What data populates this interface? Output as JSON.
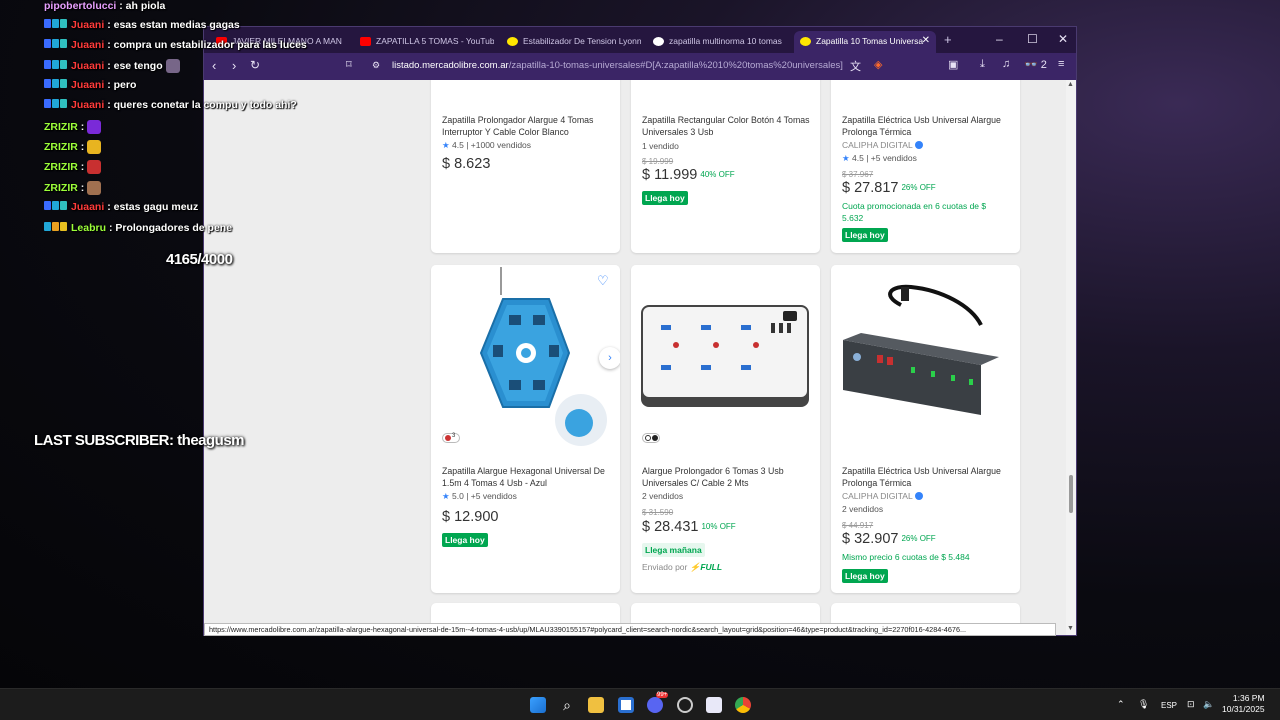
{
  "chat": {
    "messages": [
      {
        "user": "pipobertolucci",
        "color": "#e8a0ff",
        "text": ": ah piola",
        "badges": 0
      },
      {
        "user": "Juaani",
        "color": "#ff3b3b",
        "text": ": esas estan medias gagas",
        "badges": 3
      },
      {
        "user": "Juaani",
        "color": "#ff3b3b",
        "text": ": compra un estabilizador para las luces",
        "badges": 3
      },
      {
        "user": "Juaani",
        "color": "#ff3b3b",
        "text": ": ese tengo",
        "badges": 3
      },
      {
        "user": "Juaani",
        "color": "#ff3b3b",
        "text": ": pero",
        "badges": 3
      },
      {
        "user": "Juaani",
        "color": "#ff3b3b",
        "text": ": queres conetar la compu y todo ahi?",
        "badges": 3
      },
      {
        "user": "ZRIZIR",
        "color": "#9cff3a",
        "text": ":",
        "badges": 0
      },
      {
        "user": "ZRIZIR",
        "color": "#9cff3a",
        "text": ":",
        "badges": 0
      },
      {
        "user": "ZRIZIR",
        "color": "#9cff3a",
        "text": ":",
        "badges": 0
      },
      {
        "user": "ZRIZIR",
        "color": "#9cff3a",
        "text": ":",
        "badges": 0
      },
      {
        "user": "Juaani",
        "color": "#ff3b3b",
        "text": ": estas gagu meuz",
        "badges": 3
      },
      {
        "user": "Leabru",
        "color": "#9cff3a",
        "text": ": Prolongadores de pene",
        "badges": 3
      }
    ],
    "counter": "4165/4000",
    "last_subscriber": "LAST SUBSCRIBER: theagusm"
  },
  "browser": {
    "tabs": [
      {
        "label": "JAVIER MILEI MANO A MAN",
        "color": "#ff0000"
      },
      {
        "label": "ZAPATILLA 5 TOMAS - YouTube",
        "color": "#ff0000"
      },
      {
        "label": "Estabilizador De Tension Lyonn",
        "color": "#ffe600"
      },
      {
        "label": "zapatilla multinorma 10 tomas",
        "color": "#ffffff"
      },
      {
        "label": "Zapatilla 10 Tomas Universa",
        "color": "#ffe600"
      }
    ],
    "url_host": "listado.mercadolibre.com.ar",
    "url_rest": "/zapatilla-10-tomas-universales#D[A:zapatilla%2010%20tomas%20universales]",
    "ext_count": "2",
    "status_url": "https://www.mercadolibre.com.ar/zapatilla-alargue-hexagonal-universal-de-15m--4-tomas-4-usb/up/MLAU3390155157#polycard_client=search-nordic&search_layout=grid&position=46&type=product&tracking_id=2270f016-4284-4676..."
  },
  "products_top": [
    {
      "title": "Zapatilla Prolongador Alargue 4 Tomas Interruptor Y Cable Color Blanco",
      "rating": "4.5",
      "rating_text": "| +1000 vendidos",
      "price": "$ 8.623"
    },
    {
      "title": "Zapatilla Rectangular Color Botón 4 Tomas Universales 3 Usb",
      "sales": "1 vendido",
      "original": "$ 19.999",
      "price": "$ 11.999",
      "off": "40% OFF",
      "tag": "Llega hoy"
    },
    {
      "title": "Zapatilla Eléctrica Usb Universal Alargue Prolonga Térmica",
      "seller": "CALIPHA DIGITAL",
      "rating": "4.5",
      "rating_text": "| +5 vendidos",
      "original": "$ 37.967",
      "price": "$ 27.817",
      "off": "26% OFF",
      "promo": "Cuota promocionada en 6 cuotas de $ 5.632",
      "tag": "Llega hoy"
    }
  ],
  "products_bottom": [
    {
      "title": "Zapatilla Alargue Hexagonal Universal De 1.5m 4 Tomas 4 Usb - Azul",
      "rating": "5.0",
      "rating_text": "| +5 vendidos",
      "price": "$ 12.900",
      "tag": "Llega hoy",
      "swatch_count": "3"
    },
    {
      "title": "Alargue Prolongador 6 Tomas 3 Usb Universales C/ Cable 2 Mts",
      "sales": "2 vendidos",
      "original": "$ 31.590",
      "price": "$ 28.431",
      "off": "10% OFF",
      "tag": "Llega mañana",
      "ship": "Enviado por",
      "full": "FULL"
    },
    {
      "title": "Zapatilla Eléctrica Usb Universal Alargue Prolonga Térmica",
      "seller": "CALIPHA DIGITAL",
      "sales": "2 vendidos",
      "original": "$ 44.917",
      "price": "$ 32.907",
      "off": "26% OFF",
      "promo": "Mismo precio 6 cuotas de $ 5.484",
      "tag": "Llega hoy"
    }
  ],
  "taskbar": {
    "lang": "ESP",
    "time": "1:36 PM",
    "date": "10/31/2025",
    "notif": "99+"
  }
}
